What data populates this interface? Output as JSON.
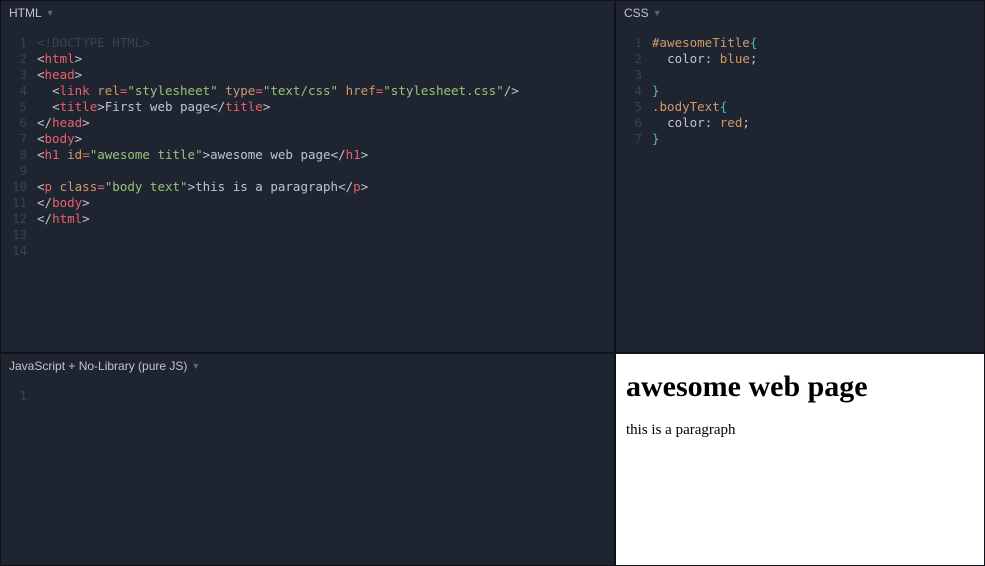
{
  "html_pane": {
    "label": "HTML",
    "lines": [
      [
        {
          "c": "tok-comment",
          "t": "<!DOCTYPE HTML>"
        }
      ],
      [
        {
          "c": "tok-br",
          "t": "<"
        },
        {
          "c": "tok-tag",
          "t": "html"
        },
        {
          "c": "tok-br",
          "t": ">"
        }
      ],
      [
        {
          "c": "tok-br",
          "t": "<"
        },
        {
          "c": "tok-tag",
          "t": "head"
        },
        {
          "c": "tok-br",
          "t": ">"
        }
      ],
      [
        {
          "c": "tok-text",
          "t": "  "
        },
        {
          "c": "tok-br",
          "t": "<"
        },
        {
          "c": "tok-tag",
          "t": "link"
        },
        {
          "c": "tok-text",
          "t": " "
        },
        {
          "c": "tok-attr",
          "t": "rel"
        },
        {
          "c": "tok-eq",
          "t": "="
        },
        {
          "c": "tok-str",
          "t": "\"stylesheet\""
        },
        {
          "c": "tok-text",
          "t": " "
        },
        {
          "c": "tok-attr",
          "t": "type"
        },
        {
          "c": "tok-eq",
          "t": "="
        },
        {
          "c": "tok-str",
          "t": "\"text/css\""
        },
        {
          "c": "tok-text",
          "t": " "
        },
        {
          "c": "tok-attr",
          "t": "href"
        },
        {
          "c": "tok-eq",
          "t": "="
        },
        {
          "c": "tok-str",
          "t": "\"stylesheet.css\""
        },
        {
          "c": "tok-br",
          "t": "/>"
        }
      ],
      [
        {
          "c": "tok-text",
          "t": "  "
        },
        {
          "c": "tok-br",
          "t": "<"
        },
        {
          "c": "tok-tag",
          "t": "title"
        },
        {
          "c": "tok-br",
          "t": ">"
        },
        {
          "c": "tok-text",
          "t": "First web page"
        },
        {
          "c": "tok-br",
          "t": "</"
        },
        {
          "c": "tok-tag",
          "t": "title"
        },
        {
          "c": "tok-br",
          "t": ">"
        }
      ],
      [
        {
          "c": "tok-br",
          "t": "</"
        },
        {
          "c": "tok-tag",
          "t": "head"
        },
        {
          "c": "tok-br",
          "t": ">"
        }
      ],
      [
        {
          "c": "tok-br",
          "t": "<"
        },
        {
          "c": "tok-tag",
          "t": "body"
        },
        {
          "c": "tok-br",
          "t": ">"
        }
      ],
      [
        {
          "c": "tok-br",
          "t": "<"
        },
        {
          "c": "tok-tag",
          "t": "h1"
        },
        {
          "c": "tok-text",
          "t": " "
        },
        {
          "c": "tok-attr",
          "t": "id"
        },
        {
          "c": "tok-eq",
          "t": "="
        },
        {
          "c": "tok-str",
          "t": "\"awesome title\""
        },
        {
          "c": "tok-br",
          "t": ">"
        },
        {
          "c": "tok-text",
          "t": "awesome web page"
        },
        {
          "c": "tok-br",
          "t": "</"
        },
        {
          "c": "tok-tag",
          "t": "h1"
        },
        {
          "c": "tok-br",
          "t": ">"
        }
      ],
      [],
      [
        {
          "c": "tok-br",
          "t": "<"
        },
        {
          "c": "tok-tag",
          "t": "p"
        },
        {
          "c": "tok-text",
          "t": " "
        },
        {
          "c": "tok-attr",
          "t": "class"
        },
        {
          "c": "tok-eq",
          "t": "="
        },
        {
          "c": "tok-str",
          "t": "\"body text\""
        },
        {
          "c": "tok-br",
          "t": ">"
        },
        {
          "c": "tok-text",
          "t": "this is a paragraph"
        },
        {
          "c": "tok-br",
          "t": "</"
        },
        {
          "c": "tok-tag",
          "t": "p"
        },
        {
          "c": "tok-br",
          "t": ">"
        }
      ],
      [
        {
          "c": "tok-br",
          "t": "</"
        },
        {
          "c": "tok-tag",
          "t": "body"
        },
        {
          "c": "tok-br",
          "t": ">"
        }
      ],
      [
        {
          "c": "tok-br",
          "t": "</"
        },
        {
          "c": "tok-tag",
          "t": "html"
        },
        {
          "c": "tok-br",
          "t": ">"
        }
      ],
      [],
      []
    ]
  },
  "css_pane": {
    "label": "CSS",
    "lines": [
      [
        {
          "c": "tok-sel",
          "t": "#awesomeTitle"
        },
        {
          "c": "tok-punct",
          "t": "{"
        }
      ],
      [
        {
          "c": "tok-text",
          "t": "  "
        },
        {
          "c": "tok-prop",
          "t": "color"
        },
        {
          "c": "tok-text",
          "t": ": "
        },
        {
          "c": "tok-val",
          "t": "blue"
        },
        {
          "c": "tok-text",
          "t": ";"
        }
      ],
      [],
      [
        {
          "c": "tok-punct",
          "t": "}"
        }
      ],
      [
        {
          "c": "tok-sel",
          "t": ".bodyText"
        },
        {
          "c": "tok-punct",
          "t": "{"
        }
      ],
      [
        {
          "c": "tok-text",
          "t": "  "
        },
        {
          "c": "tok-prop",
          "t": "color"
        },
        {
          "c": "tok-text",
          "t": ": "
        },
        {
          "c": "tok-val",
          "t": "red"
        },
        {
          "c": "tok-text",
          "t": ";"
        }
      ],
      [
        {
          "c": "tok-punct",
          "t": "}"
        }
      ]
    ]
  },
  "js_pane": {
    "label": "JavaScript + No-Library (pure JS)",
    "lines": [
      []
    ]
  },
  "result": {
    "heading": "awesome web page",
    "paragraph": "this is a paragraph"
  }
}
